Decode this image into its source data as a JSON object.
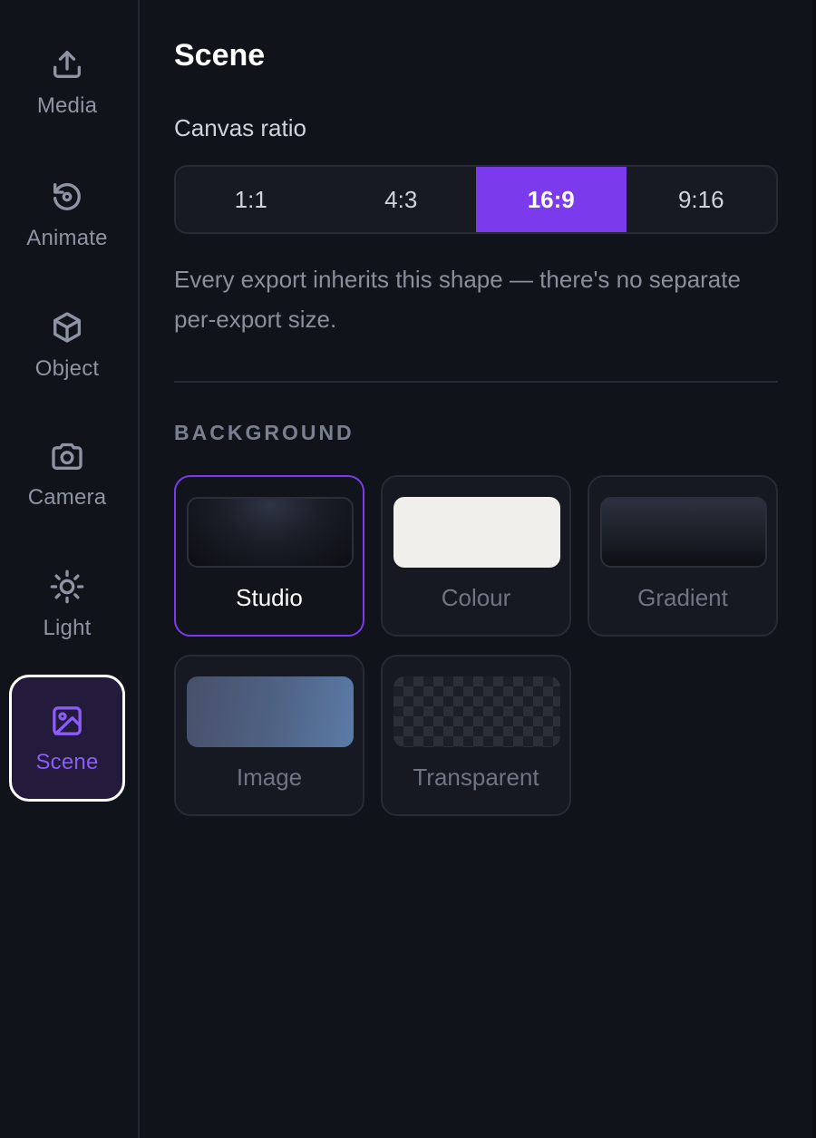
{
  "sidebar": {
    "items": [
      {
        "label": "Media",
        "icon": "upload-icon",
        "active": false
      },
      {
        "label": "Animate",
        "icon": "rotate-icon",
        "active": false
      },
      {
        "label": "Object",
        "icon": "cube-icon",
        "active": false
      },
      {
        "label": "Camera",
        "icon": "camera-icon",
        "active": false
      },
      {
        "label": "Light",
        "icon": "sun-icon",
        "active": false
      },
      {
        "label": "Scene",
        "icon": "image-icon",
        "active": true
      }
    ]
  },
  "panel": {
    "title": "Scene",
    "canvas_ratio": {
      "label": "Canvas ratio",
      "options": [
        "1:1",
        "4:3",
        "16:9",
        "9:16"
      ],
      "selected": "16:9"
    },
    "help_text": "Every export inherits this shape — there's no separate per-export size.",
    "background": {
      "heading": "BACKGROUND",
      "options": [
        {
          "label": "Studio",
          "selected": true
        },
        {
          "label": "Colour",
          "selected": false
        },
        {
          "label": "Gradient",
          "selected": false
        },
        {
          "label": "Image",
          "selected": false
        },
        {
          "label": "Transparent",
          "selected": false
        }
      ]
    }
  },
  "colors": {
    "accent": "#7c3aed",
    "accent_text": "#8b5cf6",
    "background": "#11131a",
    "surface": "#171a22",
    "border": "#262b36"
  }
}
